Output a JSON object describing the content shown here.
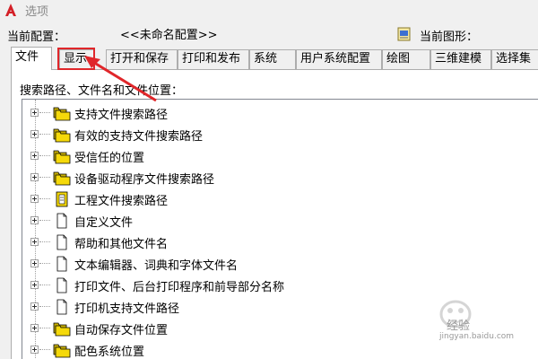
{
  "window": {
    "title": "选项"
  },
  "config": {
    "current_config_label": "当前配置：",
    "current_config_value": "<<未命名配置>>",
    "current_drawing_label": "当前图形："
  },
  "tabs": [
    {
      "label": "文件",
      "active": true
    },
    {
      "label": "显示",
      "active": false,
      "highlighted": true
    },
    {
      "label": "打开和保存",
      "active": false
    },
    {
      "label": "打印和发布",
      "active": false
    },
    {
      "label": "系统",
      "active": false
    },
    {
      "label": "用户系统配置",
      "active": false
    },
    {
      "label": "绘图",
      "active": false
    },
    {
      "label": "三维建模",
      "active": false
    },
    {
      "label": "选择集",
      "active": false
    }
  ],
  "panel": {
    "search_label": "搜索路径、文件名和文件位置："
  },
  "tree": {
    "items": [
      {
        "label": "支持文件搜索路径",
        "icon": "folder-stack-icon"
      },
      {
        "label": "有效的支持文件搜索路径",
        "icon": "folder-stack-icon"
      },
      {
        "label": "受信任的位置",
        "icon": "folder-stack-icon"
      },
      {
        "label": "设备驱动程序文件搜索路径",
        "icon": "folder-stack-icon"
      },
      {
        "label": "工程文件搜索路径",
        "icon": "project-file-icon"
      },
      {
        "label": "自定义文件",
        "icon": "document-icon"
      },
      {
        "label": "帮助和其他文件名",
        "icon": "document-icon"
      },
      {
        "label": "文本编辑器、词典和字体文件名",
        "icon": "document-icon"
      },
      {
        "label": "打印文件、后台打印程序和前导部分名称",
        "icon": "document-icon"
      },
      {
        "label": "打印机支持文件路径",
        "icon": "document-icon"
      },
      {
        "label": "自动保存文件位置",
        "icon": "folder-stack-icon"
      },
      {
        "label": "配色系统位置",
        "icon": "folder-stack-icon"
      }
    ]
  },
  "watermark": {
    "text": "经验",
    "url": "jingyan.baidu.com"
  },
  "colors": {
    "highlight": "#e0262a",
    "folder": "#f5d90a",
    "app_icon": "#d42027"
  }
}
